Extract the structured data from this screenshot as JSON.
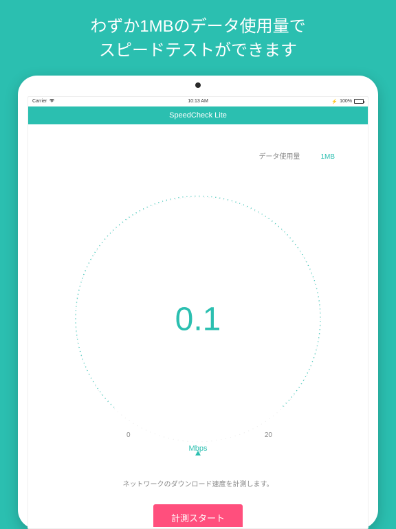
{
  "promo": {
    "line1": "わずか1MBのデータ使用量で",
    "line2": "スピードテストができます"
  },
  "status_bar": {
    "carrier": "Carrier",
    "time": "10:13 AM",
    "battery_pct": "100%"
  },
  "nav": {
    "title": "SpeedCheck Lite"
  },
  "data_usage": {
    "label": "データ使用量",
    "value": "1MB"
  },
  "gauge": {
    "speed_value": "0.1",
    "unit": "Mbps",
    "tick_min": "0",
    "tick_max": "20"
  },
  "description": "ネットワークのダウンロード速度を計測します。",
  "actions": {
    "start_label": "計測スタート"
  },
  "colors": {
    "accent": "#2bbfb0",
    "action": "#ff4f7d"
  },
  "chart_data": {
    "type": "other",
    "gauge": {
      "min": 0,
      "max": 20,
      "value": 0.1,
      "unit": "Mbps"
    }
  }
}
